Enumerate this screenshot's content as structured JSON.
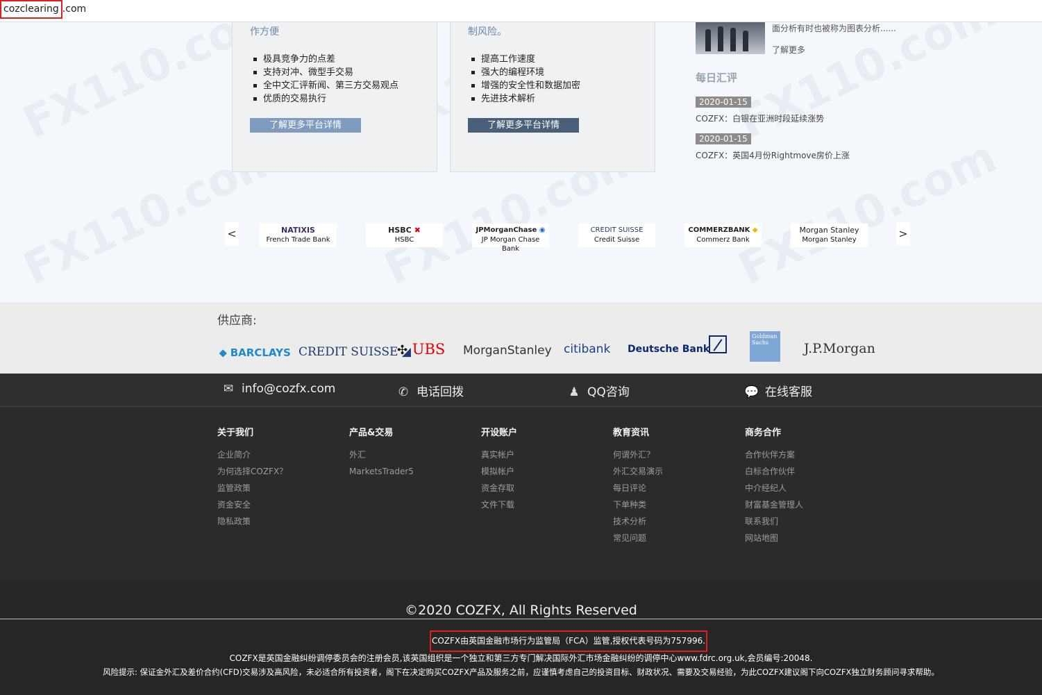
{
  "address_bar": {
    "domain_highlight": "cozclearing",
    "domain_rest": ".com"
  },
  "platform_left": {
    "subtitle": "作方便",
    "features": [
      "极具竞争力的点差",
      "支持对冲、微型手交易",
      "全中文汇评新闻、第三方交易观点",
      "优质的交易执行"
    ],
    "button": "了解更多平台详情"
  },
  "platform_mid": {
    "subtitle": "制风险。",
    "features": [
      "提高工作速度",
      "强大的编程环境",
      "增强的安全性和数据加密",
      "先进技术解析"
    ],
    "button": "了解更多平台详情"
  },
  "news": {
    "snippet": "面分析有时也被称为图表分析......",
    "more": "了解更多",
    "daily_title": "每日汇评",
    "items": [
      {
        "date": "2020-01-15",
        "text": "COZFX：白银在亚洲时段延续涨势"
      },
      {
        "date": "2020-01-15",
        "text": "COZFX：英国4月份Rightmove房价上涨"
      }
    ]
  },
  "carousel": {
    "prev": "<",
    "next": ">",
    "banks": [
      {
        "logo": "NATIXIS",
        "name": "French Trade Bank"
      },
      {
        "logo": "HSBC",
        "name": "HSBC"
      },
      {
        "logo": "JPMorganChase",
        "name": "JP Morgan Chase Bank"
      },
      {
        "logo": "CREDIT SUISSE",
        "name": "Credit Suisse"
      },
      {
        "logo": "COMMERZBANK",
        "name": "Commerz Bank"
      },
      {
        "logo": "Morgan Stanley",
        "name": "Morgan Stanley"
      }
    ]
  },
  "suppliers": {
    "title": "供应商:",
    "logos": [
      "BARCLAYS",
      "CREDIT SUISSE",
      "UBS",
      "MorganStanley",
      "citibank",
      "Deutsche Bank",
      "Goldman Sachs",
      "J.P.Morgan"
    ]
  },
  "contact": {
    "email": "info@cozfx.com",
    "callback": "电话回拨",
    "qq": "QQ咨询",
    "online": "在线客服"
  },
  "footer_columns": [
    {
      "heading": "关于我们",
      "links": [
        "企业简介",
        "为何选择COZFX？",
        "监管政策",
        "资金安全",
        "隐私政策"
      ]
    },
    {
      "heading": "产品&交易",
      "links": [
        "外汇",
        "MarketsTrader5"
      ]
    },
    {
      "heading": "开设账户",
      "links": [
        "真实帐户",
        "模拟帐户",
        "资金存取",
        "文件下载"
      ]
    },
    {
      "heading": "教育资讯",
      "links": [
        "何谓外汇？",
        "外汇交易演示",
        "每日评论",
        "下单种类",
        "技术分析",
        "常见问题"
      ]
    },
    {
      "heading": "商务合作",
      "links": [
        "合作伙伴方案",
        "白标合作伙伴",
        "中介经纪人",
        "财富基金管理人",
        "联系我们",
        "网站地图"
      ]
    }
  ],
  "bottom": {
    "copyright": "©2020 COZFX, All Rights Reserved",
    "fca": "COZFX由英国金融市场行为监管局（FCA）监管,授权代表号码为757996.",
    "registration": "COZFX是英国金融纠纷调停委员会的注册会员,该英国组织是一个独立和第三方专门解决国际外汇市场金融纠纷的调停中心www.fdrc.org.uk,会员编号:20048.",
    "risk": "风险提示: 保证金外汇及差价合约(CFD)交易涉及高风险，未必适合所有投资者，阁下在决定购买COZFX产品及服务之前，应谨慎考虑自己的投资目标、财政状况、需要及交易经验，为此COZFX建议阁下向COZFX独立财务顾问寻求帮助。"
  },
  "watermark": "FX110.com",
  "colors": {
    "highlight_red": "#e02020",
    "button_light": "#7f9bbd",
    "button_dark": "#4a6078",
    "footer_bg": "#2b2b2b"
  }
}
